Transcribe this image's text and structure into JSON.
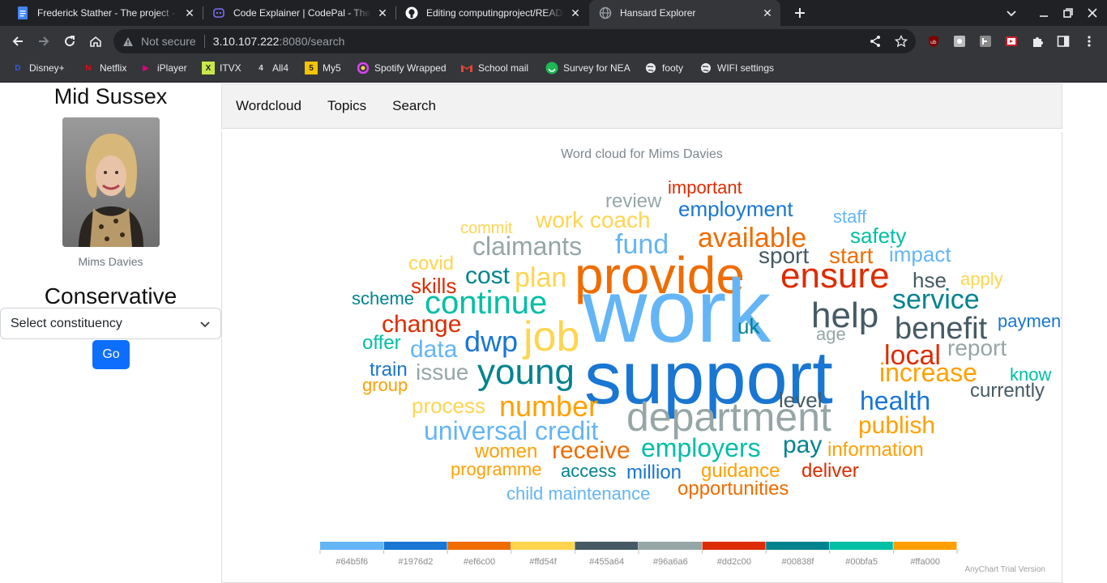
{
  "browser": {
    "tabs": [
      {
        "title": "Frederick Stather - The project - G",
        "favicon": "google-docs-icon",
        "color": "#4285f4"
      },
      {
        "title": "Code Explainer | CodePal - The U",
        "favicon": "codepal-icon",
        "color": "#7c6cf0"
      },
      {
        "title": "Editing computingproject/READI",
        "favicon": "github-icon",
        "color": "#ffffff"
      },
      {
        "title": "Hansard Explorer",
        "favicon": "globe-icon",
        "color": "#9aa0a6"
      }
    ],
    "address": {
      "not_secure": "Not secure",
      "host": "3.10.107.222",
      "path": ":8080/search"
    },
    "bookmarks": [
      {
        "label": "Disney+",
        "icon": "disney-icon",
        "color": "#1a3bb3",
        "glyph": "D"
      },
      {
        "label": "Netflix",
        "icon": "netflix-icon",
        "color": "#e50914",
        "glyph": "N"
      },
      {
        "label": "iPlayer",
        "icon": "iplayer-icon",
        "color": "#e4007c",
        "glyph": "▶"
      },
      {
        "label": "ITVX",
        "icon": "itvx-icon",
        "color": "#c7e84a",
        "glyph": "X"
      },
      {
        "label": "All4",
        "icon": "all4-icon",
        "color": "#cccccc",
        "glyph": "4"
      },
      {
        "label": "My5",
        "icon": "my5-icon",
        "color": "#f5c400",
        "glyph": "5"
      },
      {
        "label": "Spotify Wrapped",
        "icon": "spotify-wrapped-icon",
        "color": "#e040fb",
        "glyph": "◉"
      },
      {
        "label": "School mail",
        "icon": "gmail-icon",
        "color": "#ea4335",
        "glyph": "M"
      },
      {
        "label": "Survey for NEA",
        "icon": "survey-icon",
        "color": "#1db954",
        "glyph": "☺"
      },
      {
        "label": "footy",
        "icon": "globe-icon",
        "color": "#e8eaed",
        "glyph": "◍"
      },
      {
        "label": "WIFI settings",
        "icon": "globe-icon",
        "color": "#e8eaed",
        "glyph": "◍"
      }
    ]
  },
  "sidebar": {
    "constituency": "Mid Sussex",
    "mp_name": "Mims Davies",
    "party": "Conservative",
    "select_label": "Select constituency",
    "go_label": "Go"
  },
  "nav": {
    "items": [
      "Wordcloud",
      "Topics",
      "Search"
    ]
  },
  "chart_data": {
    "type": "wordcloud",
    "title": "Word cloud for Mims Davies",
    "palette": [
      "#64b5f6",
      "#1976d2",
      "#ef6c00",
      "#ffd54f",
      "#455a64",
      "#96a6a6",
      "#dd2c00",
      "#00838f",
      "#00bfa5",
      "#ffa000"
    ],
    "words": [
      {
        "text": "review",
        "color": "#96a6a6"
      },
      {
        "text": "important",
        "color": "#dd2c00"
      },
      {
        "text": "commit",
        "color": "#ffd54f"
      },
      {
        "text": "work coach",
        "color": "#ffd54f"
      },
      {
        "text": "employment",
        "color": "#1976d2"
      },
      {
        "text": "staff",
        "color": "#64b5f6"
      },
      {
        "text": "claimants",
        "color": "#96a6a6"
      },
      {
        "text": "fund",
        "color": "#64b5f6"
      },
      {
        "text": "available",
        "color": "#ef6c00"
      },
      {
        "text": "safety",
        "color": "#00bfa5"
      },
      {
        "text": "covid",
        "color": "#ffd54f"
      },
      {
        "text": "sport",
        "color": "#455a64"
      },
      {
        "text": "start",
        "color": "#ef6c00"
      },
      {
        "text": "impact",
        "color": "#64b5f6"
      },
      {
        "text": "provide",
        "color": "#ef6c00"
      },
      {
        "text": "cost",
        "color": "#00838f"
      },
      {
        "text": "plan",
        "color": "#ffd54f"
      },
      {
        "text": "ensure",
        "color": "#dd2c00"
      },
      {
        "text": "apply",
        "color": "#ffd54f"
      },
      {
        "text": "skills",
        "color": "#dd2c00"
      },
      {
        "text": "hse",
        "color": "#455a64"
      },
      {
        "text": "scheme",
        "color": "#00838f"
      },
      {
        "text": "continue",
        "color": "#00bfa5"
      },
      {
        "text": "service",
        "color": "#00838f"
      },
      {
        "text": "work",
        "color": "#64b5f6"
      },
      {
        "text": "help",
        "color": "#455a64"
      },
      {
        "text": "change",
        "color": "#dd2c00"
      },
      {
        "text": "payments",
        "color": "#1976d2"
      },
      {
        "text": "uk",
        "color": "#00838f"
      },
      {
        "text": "benefit",
        "color": "#455a64"
      },
      {
        "text": "age",
        "color": "#96a6a6"
      },
      {
        "text": "offer",
        "color": "#00bfa5"
      },
      {
        "text": "dwp",
        "color": "#1976d2"
      },
      {
        "text": "job",
        "color": "#ffd54f"
      },
      {
        "text": "data",
        "color": "#64b5f6"
      },
      {
        "text": "report",
        "color": "#96a6a6"
      },
      {
        "text": "local",
        "color": "#dd2c00"
      },
      {
        "text": "train",
        "color": "#1976d2"
      },
      {
        "text": "issue",
        "color": "#96a6a6"
      },
      {
        "text": "young",
        "color": "#00838f"
      },
      {
        "text": "support",
        "color": "#1976d2"
      },
      {
        "text": "increase",
        "color": "#ffa000"
      },
      {
        "text": "know",
        "color": "#00bfa5"
      },
      {
        "text": "group",
        "color": "#ffa000"
      },
      {
        "text": "currently",
        "color": "#455a64"
      },
      {
        "text": "level",
        "color": "#455a64"
      },
      {
        "text": "process",
        "color": "#ffd54f"
      },
      {
        "text": "number",
        "color": "#ffa000"
      },
      {
        "text": "health",
        "color": "#1976d2"
      },
      {
        "text": "department",
        "color": "#96a6a6"
      },
      {
        "text": "universal credit",
        "color": "#64b5f6"
      },
      {
        "text": "publish",
        "color": "#ffa000"
      },
      {
        "text": "women",
        "color": "#ffa000"
      },
      {
        "text": "receive",
        "color": "#ef6c00"
      },
      {
        "text": "employers",
        "color": "#00bfa5"
      },
      {
        "text": "pay",
        "color": "#00838f"
      },
      {
        "text": "information",
        "color": "#ffa000"
      },
      {
        "text": "programme",
        "color": "#ffa000"
      },
      {
        "text": "access",
        "color": "#00838f"
      },
      {
        "text": "million",
        "color": "#1976d2"
      },
      {
        "text": "guidance",
        "color": "#ffa000"
      },
      {
        "text": "deliver",
        "color": "#dd2c00"
      },
      {
        "text": "child maintenance",
        "color": "#64b5f6"
      },
      {
        "text": "opportunities",
        "color": "#ef6c00"
      }
    ],
    "legend": [
      "#64b5f6",
      "#1976d2",
      "#ef6c00",
      "#ffd54f",
      "#455a64",
      "#96a6a6",
      "#dd2c00",
      "#00838f",
      "#00bfa5",
      "#ffa000"
    ]
  },
  "watermark": "AnyChart Trial Version"
}
